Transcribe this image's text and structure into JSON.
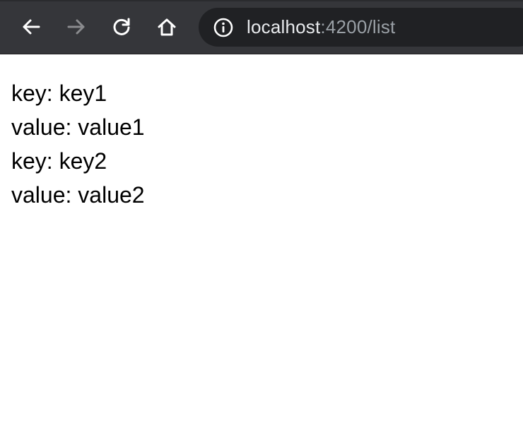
{
  "browser": {
    "url_host": "localhost",
    "url_rest": ":4200/list",
    "icons": {
      "back": "arrow-left-icon",
      "forward": "arrow-right-icon",
      "reload": "reload-icon",
      "home": "home-icon",
      "site_info": "info-icon"
    },
    "colors": {
      "toolbar": "#35363a",
      "omnibox": "#202124",
      "icon_active": "#ffffff",
      "icon_disabled": "#8a8b8e",
      "url_dim": "#9aa0a6"
    }
  },
  "page": {
    "items": [
      {
        "key_label": "key:",
        "key": "key1",
        "value_label": "value:",
        "value": "value1"
      },
      {
        "key_label": "key:",
        "key": "key2",
        "value_label": "value:",
        "value": "value2"
      }
    ]
  }
}
